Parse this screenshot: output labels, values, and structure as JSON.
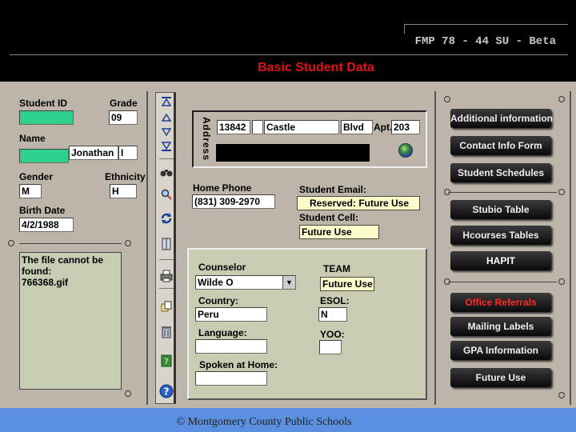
{
  "header": {
    "app_version": "FMP 78 - 44 SU - Beta",
    "screen_title": "Basic Student  Data"
  },
  "student": {
    "id_label": "Student ID",
    "id_value": "",
    "grade_label": "Grade",
    "grade_value": "09",
    "name_label": "Name",
    "last_name_value": "",
    "first_name_value": "Jonathan",
    "middle_initial_value": "I",
    "gender_label": "Gender",
    "gender_value": "M",
    "ethnicity_label": "Ethnicity",
    "ethnicity_value": "H",
    "birth_date_label": "Birth Date",
    "birth_date_value": "4/2/1988",
    "photo_message": "The file cannot be found:\n766368.gif"
  },
  "address": {
    "label": "Address",
    "number": "13842",
    "direction": "",
    "street": "Castle",
    "suffix": "Blvd",
    "apt_label": "Apt.",
    "apt_value": "203",
    "line2": ""
  },
  "contact": {
    "home_phone_label": "Home Phone",
    "home_phone_value": "(831) 309-2970",
    "email_label": "Student Email:",
    "email_value": "Reserved: Future Use",
    "cell_label": "Student Cell:",
    "cell_value": "Future Use"
  },
  "counselor": {
    "label": "Counselor",
    "value": "Wilde O",
    "team_label": "TEAM",
    "team_value": "Future Use",
    "country_label": "Country:",
    "country_value": "Peru",
    "esol_label": "ESOL:",
    "esol_value": "N",
    "language_label": "Language:",
    "language_value": "",
    "yoo_label": "YOO:",
    "yoo_value": "",
    "spoken_label": "Spoken at Home:",
    "spoken_value": ""
  },
  "toolbar": {
    "icons": [
      "first-record-icon",
      "previous-record-icon",
      "next-record-icon",
      "last-record-icon",
      "binoculars-icon",
      "magnifier-icon",
      "refresh-icon",
      "book-icon",
      "printer-icon",
      "copy-icon",
      "trash-icon",
      "help-book-icon",
      "help-icon"
    ]
  },
  "side_buttons": {
    "additional_info": "Additional information",
    "contact_info": "Contact Info Form",
    "schedules": "Student Schedules",
    "studio_table": "Stubio Table",
    "hcourses": "Hcourses Tables",
    "hapit": "HAPIT",
    "office_referrals": "Office Referrals",
    "mailing_labels": "Mailing Labels",
    "gpa": "GPA Information",
    "future_use": "Future Use"
  },
  "colors": {
    "panel": "#bdb5a9",
    "accent_red": "#e0101a",
    "footer_blue": "#5b8fe0",
    "field_green": "#2fcf8e"
  },
  "footer": {
    "copyright": "© Montgomery County Public Schools"
  }
}
